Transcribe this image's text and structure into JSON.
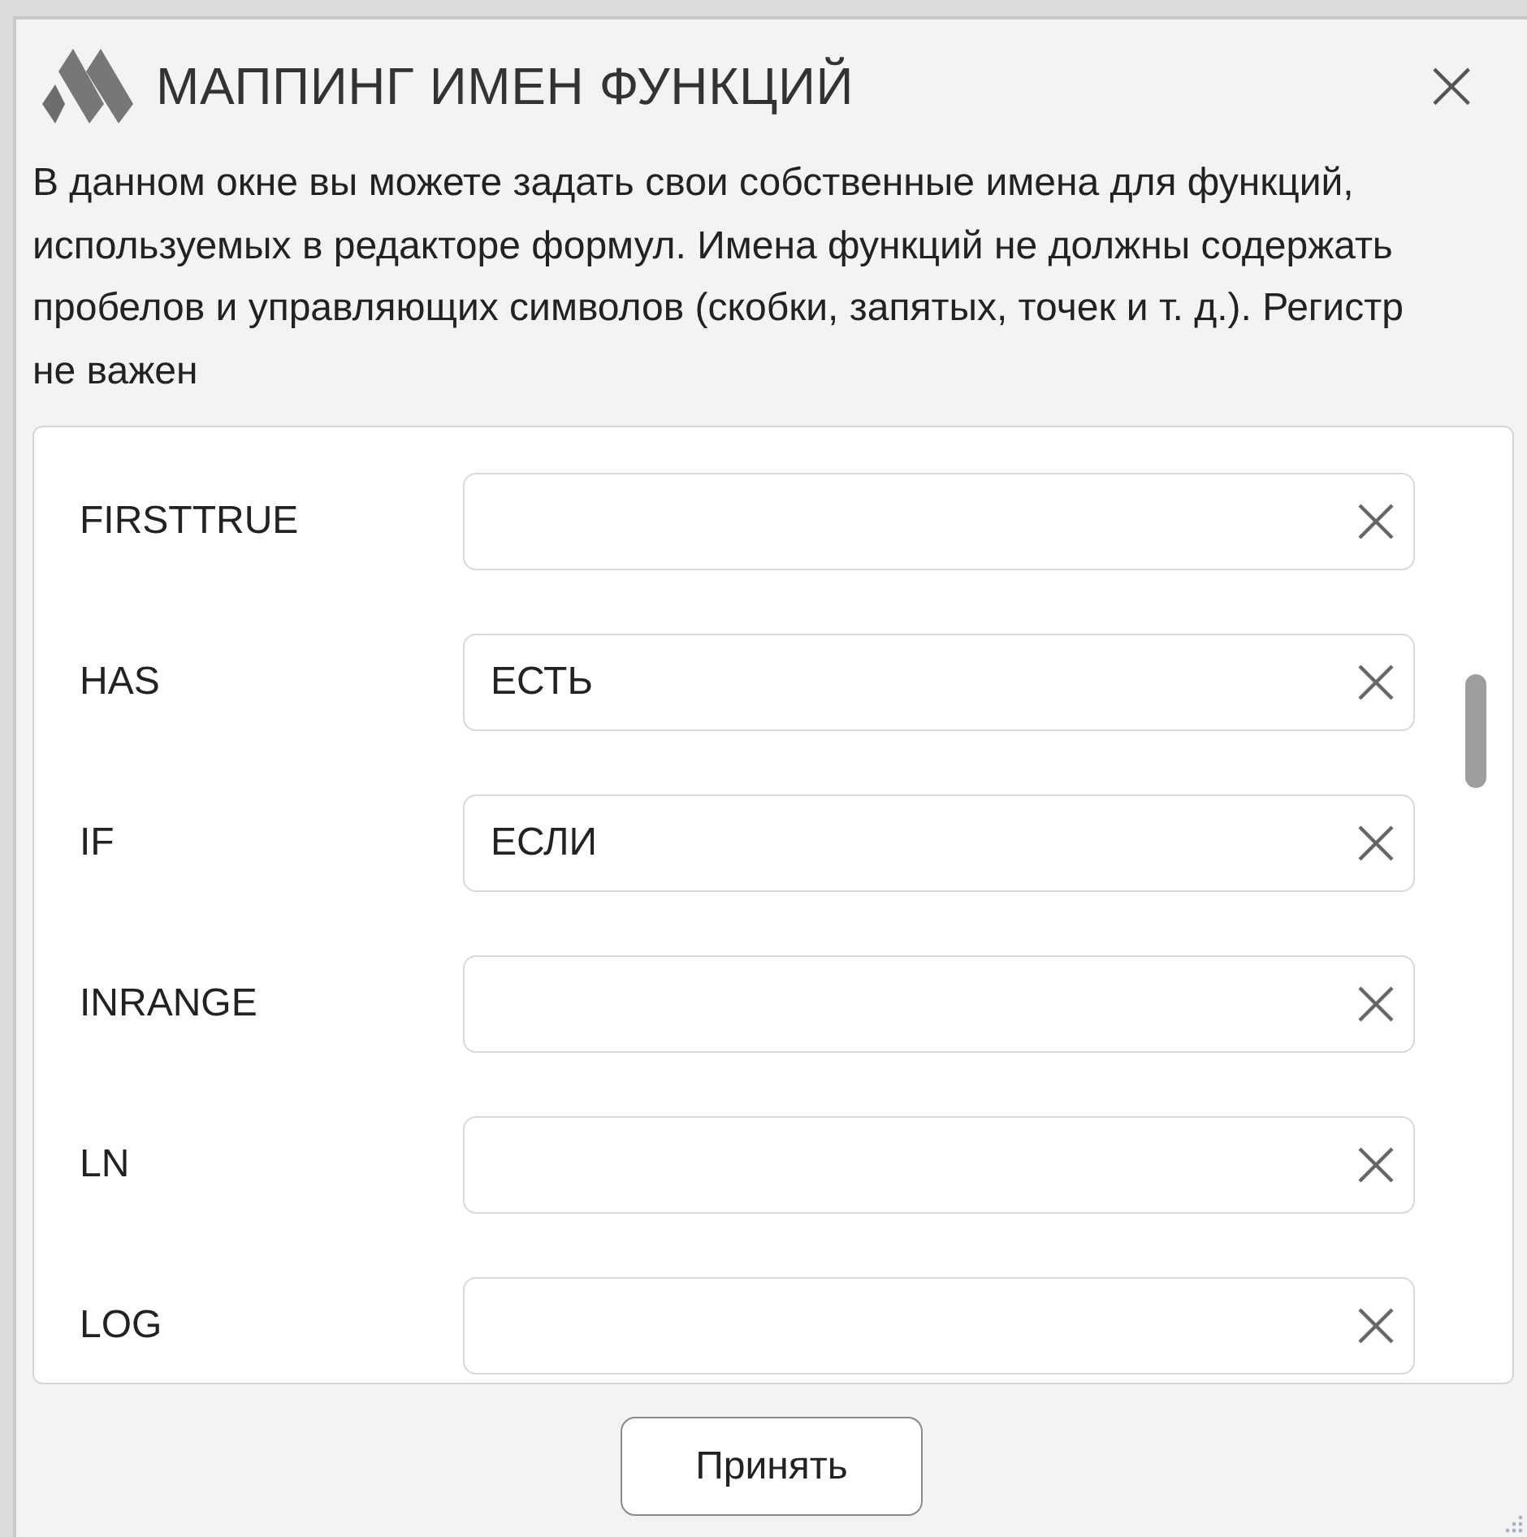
{
  "window": {
    "title": "МАППИНГ ИМЕН ФУНКЦИЙ",
    "close": "×"
  },
  "description": "В данном окне вы можете задать свои собственные имена для функций, используемых в редакторе формул. Имена функций не должны содержать пробелов и управляющих символов (скобки, запятых, точек и т. д.). Регистр не важен",
  "mappings": [
    {
      "name": "FIRSTTRUE"
    },
    {
      "name": "HAS",
      "value": "ЕСТЬ"
    },
    {
      "name": "IF",
      "value": "ЕСЛИ"
    },
    {
      "name": "INRANGE"
    },
    {
      "name": "LN"
    },
    {
      "name": "LOG"
    }
  ],
  "buttons": [
    "Принять"
  ]
}
